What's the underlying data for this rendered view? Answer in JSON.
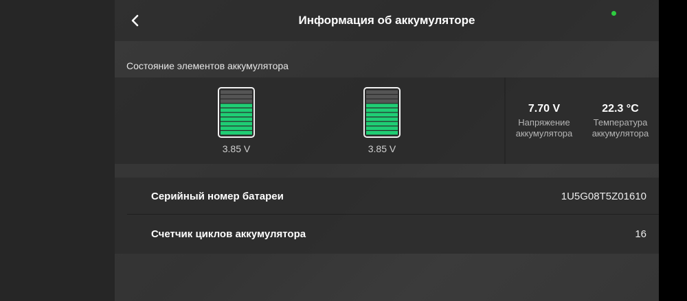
{
  "header": {
    "title": "Информация об аккумуляторе",
    "back_icon": "chevron-left-icon",
    "status_color": "#2ecc40"
  },
  "cells_section": {
    "label": "Состояние элементов аккумулятора",
    "cells": [
      {
        "voltage": "3.85 V",
        "charge_level": 0.7
      },
      {
        "voltage": "3.85 V",
        "charge_level": 0.7
      }
    ],
    "fill_color": "#1fce74"
  },
  "stats": {
    "voltage_value": "7.70 V",
    "voltage_label": "Напряжение аккумулятора",
    "temperature_value": "22.3 °C",
    "temperature_label": "Температура аккумулятора"
  },
  "info": {
    "serial_label": "Серийный номер батареи",
    "serial_value": "1U5G08T5Z01610",
    "cycles_label": "Счетчик циклов аккумулятора",
    "cycles_value": "16"
  }
}
